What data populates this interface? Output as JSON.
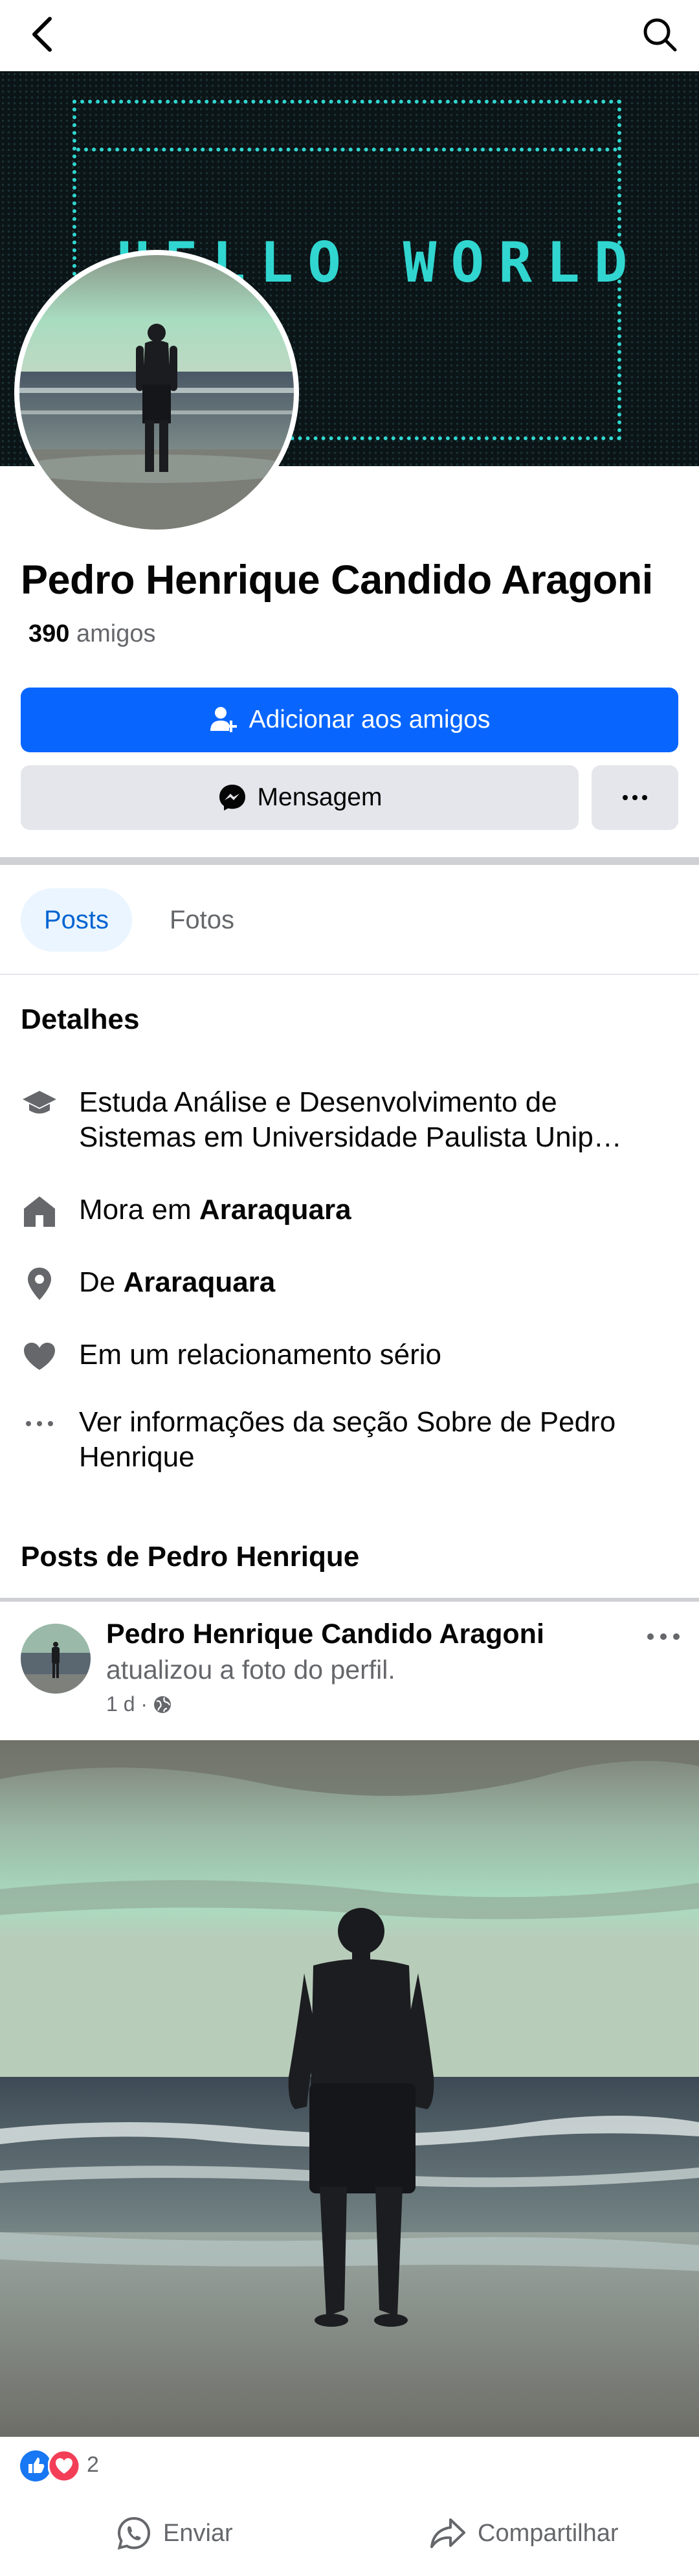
{
  "profile": {
    "name": "Pedro Henrique Candido Aragoni",
    "friends_count": "390",
    "friends_label": "amigos",
    "cover_text": "HELLO WORLD"
  },
  "actions": {
    "add_friend": "Adicionar aos amigos",
    "message": "Mensagem"
  },
  "tabs": {
    "posts": "Posts",
    "photos": "Fotos"
  },
  "details": {
    "title": "Detalhes",
    "education": "Estuda Análise e Desenvolvimento de",
    "education_line2": "Sistemas em Universidade Paulista Unip…",
    "lives_prefix": "Mora em",
    "lives_city": "Araraquara",
    "from_prefix": "De",
    "from_city": "Araraquara",
    "relationship": "Em um relacionamento sério",
    "about_line1": "Ver informações da seção Sobre de Pedro",
    "about_line2": "Henrique"
  },
  "posts_section": {
    "title": "Posts de Pedro Henrique"
  },
  "post": {
    "author": "Pedro Henrique Candido Aragoni",
    "action": "atualizou a foto do perfil.",
    "time": "1 d ·",
    "reactions_count": "2",
    "send_label": "Enviar",
    "share_label": "Compartilhar"
  },
  "colors": {
    "primary": "#0866ff",
    "secondary_button": "#e4e6eb",
    "muted_text": "#65676b",
    "cover_accent": "#31d6d0"
  }
}
